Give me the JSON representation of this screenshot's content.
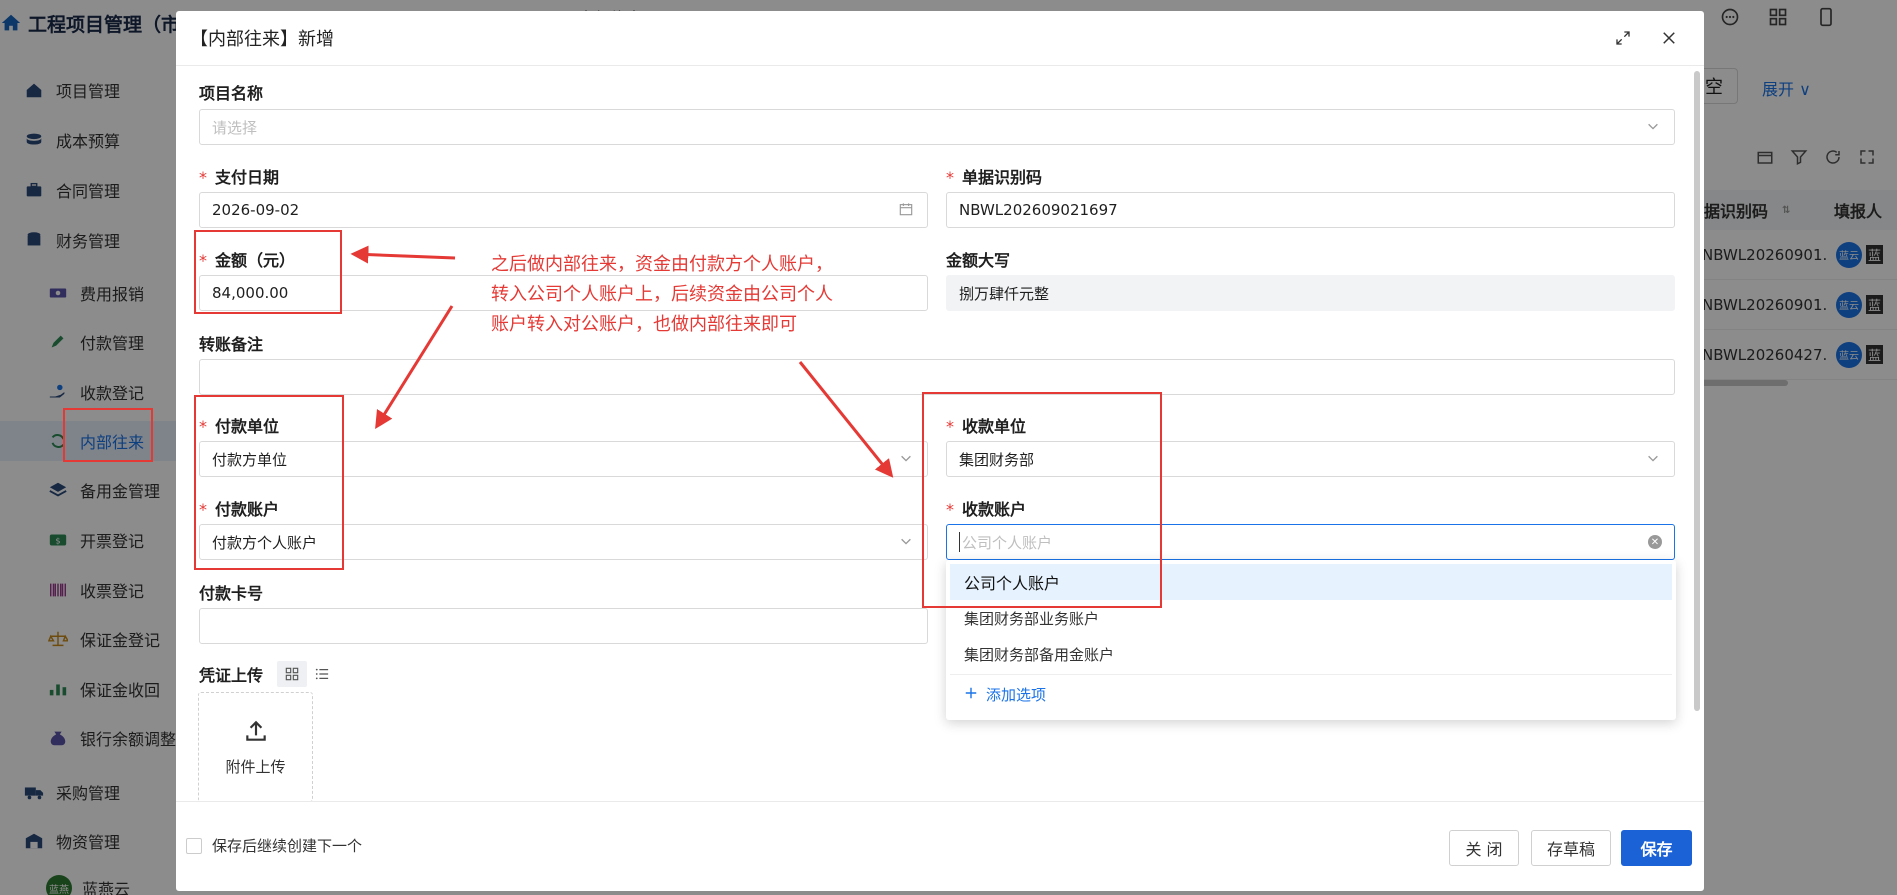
{
  "app": {
    "brand": "工程项目管理（市",
    "bg_tab": "内部往来",
    "sidebar": [
      {
        "label": "项目管理",
        "icon": "home-building-icon"
      },
      {
        "label": "成本预算",
        "icon": "coins-icon"
      },
      {
        "label": "合同管理",
        "icon": "briefcase-icon"
      },
      {
        "label": "财务管理",
        "icon": "database-icon"
      },
      {
        "label": "费用报销",
        "icon": "money-icon"
      },
      {
        "label": "付款管理",
        "icon": "edit-icon"
      },
      {
        "label": "收款登记",
        "icon": "hand-coin-icon"
      },
      {
        "label": "内部往来",
        "icon": "refresh-icon"
      },
      {
        "label": "备用金管理",
        "icon": "layers-icon"
      },
      {
        "label": "开票登记",
        "icon": "dollar-ticket-icon"
      },
      {
        "label": "收票登记",
        "icon": "barcode-icon"
      },
      {
        "label": "保证金登记",
        "icon": "scale-icon"
      },
      {
        "label": "保证金收回",
        "icon": "bar-chart-icon"
      },
      {
        "label": "银行余额调整",
        "icon": "money-bag-icon"
      },
      {
        "label": "采购管理",
        "icon": "truck-icon"
      },
      {
        "label": "物资管理",
        "icon": "warehouse-icon"
      }
    ],
    "user": {
      "avatar": "蓝燕",
      "name": "蓝燕云"
    },
    "bg_clear_btn": "空",
    "bg_expand_btn": "展开",
    "bg_table": {
      "col1": "据识别码",
      "col2": "填报人",
      "rows": [
        {
          "code": "NBWL20260901...",
          "avatar": "蓝云",
          "name": "蓝"
        },
        {
          "code": "NBWL20260901...",
          "avatar": "蓝云",
          "name": "蓝"
        },
        {
          "code": "NBWL20260427...",
          "avatar": "蓝云",
          "name": "蓝"
        }
      ]
    }
  },
  "modal": {
    "title": "【内部往来】新增",
    "form": {
      "project_label": "项目名称",
      "project_placeholder": "请选择",
      "pay_date_label": "支付日期",
      "pay_date_value": "2026-09-02",
      "doc_code_label": "单据识别码",
      "doc_code_value": "NBWL202609021697",
      "amount_label": "金额（元）",
      "amount_value": "84,000.00",
      "amount_upper_label": "金额大写",
      "amount_upper_value": "捌万肆仟元整",
      "remark_label": "转账备注",
      "payer_unit_label": "付款单位",
      "payer_unit_value": "付款方单位",
      "payee_unit_label": "收款单位",
      "payee_unit_value": "集团财务部",
      "payer_account_label": "付款账户",
      "payer_account_value": "付款方个人账户",
      "payee_account_label": "收款账户",
      "payee_account_placeholder": "公司个人账户",
      "card_no_label": "付款卡号",
      "voucher_label": "凭证上传",
      "upload_label": "附件上传"
    },
    "dropdown": {
      "options": [
        "公司个人账户",
        "集团财务部业务账户",
        "集团财务部备用金账户"
      ],
      "add_option": "添加选项"
    },
    "footer": {
      "continue_checkbox": "保存后继续创建下一个",
      "close_btn": "关 闭",
      "draft_btn": "存草稿",
      "save_btn": "保存"
    }
  },
  "annotation": {
    "lines": [
      "之后做内部往来，资金由付款方个人账户，",
      "转入公司个人账户上，后续资金由公司个人",
      "账户转入对公账户，也做内部往来即可"
    ],
    "color": "#e53935"
  }
}
